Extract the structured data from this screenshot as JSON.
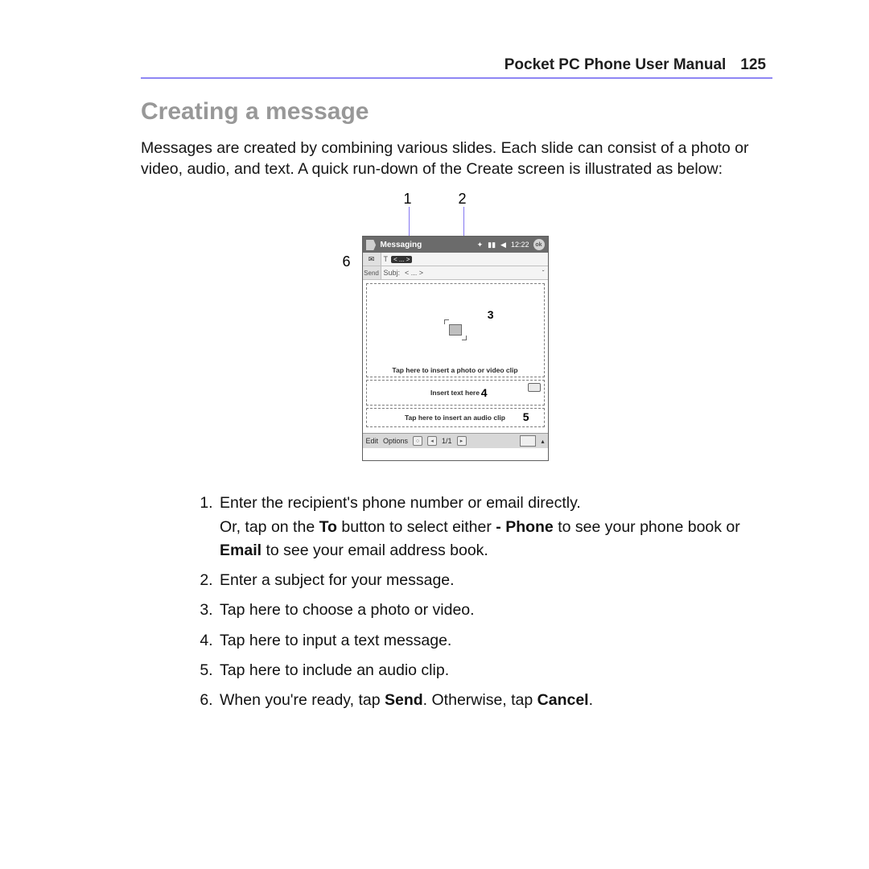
{
  "header": {
    "title": "Pocket PC Phone User Manual",
    "page": "125"
  },
  "heading": "Creating a message",
  "intro": "Messages are created by combining various slides. Each slide can consist of a photo or video, audio, and text. A quick run-down of the Create screen is illustrated as below:",
  "callouts": {
    "c1": "1",
    "c2": "2",
    "c3": "3",
    "c4": "4",
    "c5": "5",
    "c6": "6"
  },
  "phone": {
    "titlebar": {
      "app": "Messaging",
      "time": "12:22",
      "ok": "ok"
    },
    "to_label": "T",
    "to_chip": "< ... >",
    "subj_label": "Subj:",
    "subj_value": "< ... >",
    "send_label": "Send",
    "photo_hint": "Tap here to insert a photo or video clip",
    "text_hint": "Insert text here",
    "audio_hint": "Tap here to insert an audio clip",
    "menu": {
      "edit": "Edit",
      "options": "Options",
      "counter": "1/1"
    }
  },
  "steps": {
    "s1a": "Enter the recipient's phone number or email directly.",
    "s1b_pre": "Or, tap on the ",
    "s1b_to": "To",
    "s1b_mid": " button to select either ",
    "s1b_phone": "- Phone",
    "s1b_mid2": " to see your phone book or ",
    "s1b_email": "Email",
    "s1b_post": " to see your email address book.",
    "s2": "Enter a subject for your message.",
    "s3": "Tap here to choose a photo or video.",
    "s4": "Tap here to input a text message.",
    "s5": "Tap here to include an audio clip.",
    "s6_pre": "When you're ready, tap ",
    "s6_send": "Send",
    "s6_mid": ". Otherwise, tap ",
    "s6_cancel": "Cancel",
    "s6_post": "."
  }
}
